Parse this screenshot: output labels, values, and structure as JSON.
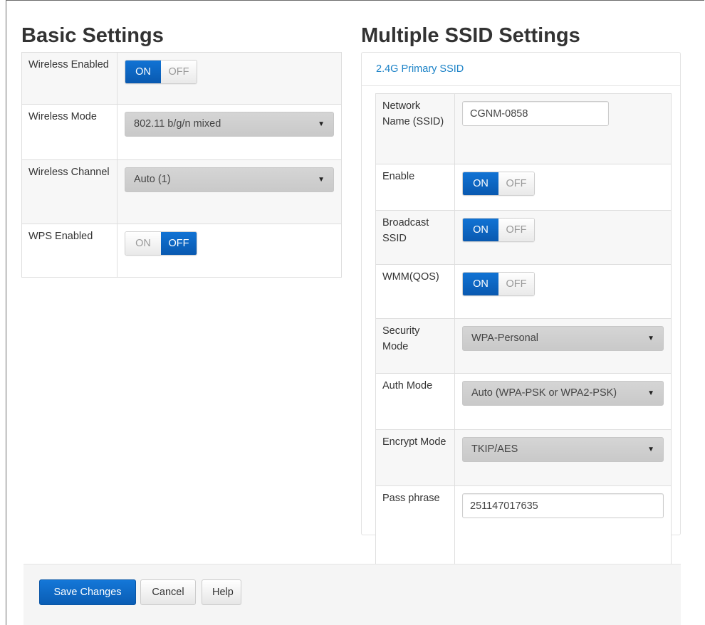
{
  "basic": {
    "title": "Basic Settings",
    "rows": [
      {
        "label": "Wireless Enabled",
        "on_label": "ON",
        "off_label": "OFF",
        "value": "ON"
      },
      {
        "label": "Wireless Mode",
        "select": "802.11 b/g/n mixed"
      },
      {
        "label": "Wireless Channel",
        "select": "Auto (1)"
      },
      {
        "label": "WPS Enabled",
        "on_label": "ON",
        "off_label": "OFF",
        "value": "OFF"
      }
    ]
  },
  "multi": {
    "title": "Multiple SSID Settings",
    "tab": "2.4G Primary SSID",
    "rows": [
      {
        "label": "Network Name (SSID)",
        "input": "CGNM-0858"
      },
      {
        "label": "Enable",
        "on_label": "ON",
        "off_label": "OFF",
        "value": "ON"
      },
      {
        "label": "Broadcast SSID",
        "on_label": "ON",
        "off_label": "OFF",
        "value": "ON"
      },
      {
        "label": "WMM(QOS)",
        "on_label": "ON",
        "off_label": "OFF",
        "value": "ON"
      },
      {
        "label": "Security Mode",
        "select": "WPA-Personal"
      },
      {
        "label": "Auth Mode",
        "select": "Auto (WPA-PSK or WPA2-PSK)"
      },
      {
        "label": "Encrypt Mode",
        "select": "TKIP/AES"
      },
      {
        "label": "Pass phrase",
        "input": "251147017635"
      }
    ]
  },
  "footer": {
    "save_label": "Save Changes",
    "cancel_label": "Cancel",
    "help_label": "Help"
  },
  "icons": {
    "select_caret": "▼"
  },
  "colors": {
    "accent": "#0a5db4",
    "link": "#1b82c7"
  }
}
